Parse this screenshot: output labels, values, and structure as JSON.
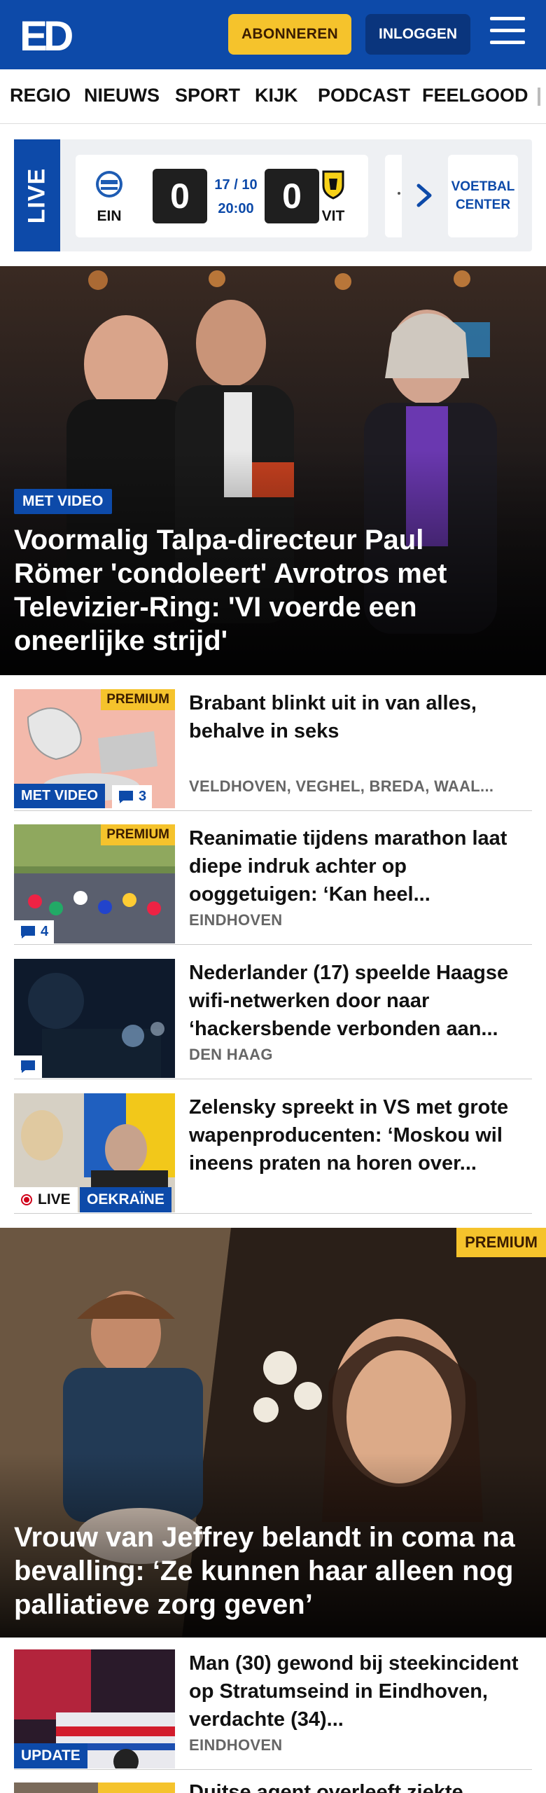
{
  "header": {
    "logo_text": "ED",
    "subscribe_label": "ABONNEREN",
    "login_label": "INLOGGEN",
    "brand_color": "#0d4aa9",
    "accent_color": "#f5c32c",
    "menu_icon": "hamburger-icon"
  },
  "nav": {
    "items": [
      "REGIO",
      "NIEUWS",
      "SPORT",
      "KIJK",
      "PODCAST",
      "FEELGOOD"
    ]
  },
  "live": {
    "label": "LIVE",
    "match": {
      "home": "EIN",
      "away": "VIT",
      "home_score": "0",
      "away_score": "0",
      "date": "17 / 10",
      "time": "20:00"
    },
    "center_line1": "VOETBAL",
    "center_line2": "CENTER"
  },
  "hero": {
    "badge": "MET VIDEO",
    "title": "Voormalig Talpa-directeur Paul Römer 'condoleert' Avrotros met Televizier-Ring: 'VI voerde een oneerlijke strijd'"
  },
  "articles": [
    {
      "title": "Brabant blinkt uit in van alles, behalve in seks",
      "location": "VELDHOVEN, VEGHEL, BREDA, WAAL...",
      "premium": "PREMIUM",
      "video": "MET VIDEO",
      "comments": "3"
    },
    {
      "title": "Reanimatie tijdens marathon laat diepe indruk achter op ooggetuigen: ‘Kan heel...",
      "location": "EINDHOVEN",
      "premium": "PREMIUM",
      "comments": "4"
    },
    {
      "title": "Nederlander (17) speelde Haagse wifi-netwerken door naar ‘hackersbende verbonden aan...",
      "location": "DEN HAAG"
    },
    {
      "title": "Zelensky spreekt in VS met grote wapenproducenten: ‘Moskou wil ineens praten na horen over...",
      "live": "LIVE",
      "topic": "OEKRAÏNE"
    }
  ],
  "feature": {
    "premium": "PREMIUM",
    "title": "Vrouw van Jeffrey belandt in coma na bevalling: ‘Ze kunnen haar alleen nog palliatieve zorg geven’"
  },
  "article_after": {
    "title": "Man (30) gewond bij steekinci­dent op Stratumseind in Eindhoven, verdachte (34)...",
    "location": "EINDHOVEN",
    "update": "UPDATE"
  },
  "article_partial": {
    "title": "Duitse agent overleeft ziekte..."
  }
}
